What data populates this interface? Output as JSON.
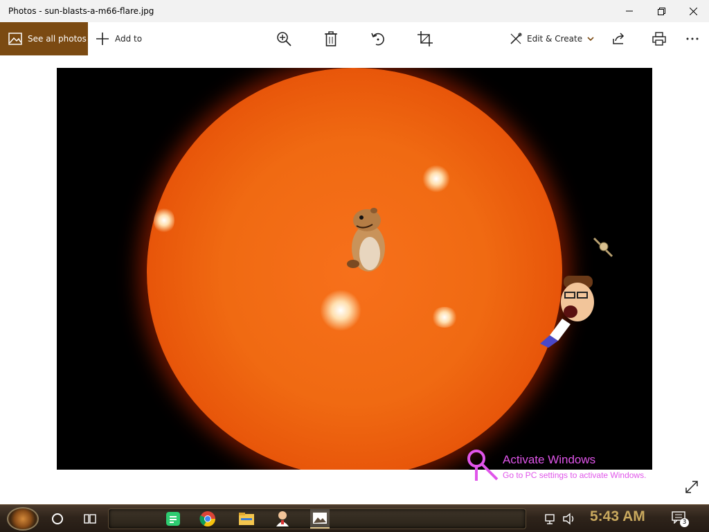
{
  "window": {
    "title": "Photos - sun-blasts-a-m66-flare.jpg",
    "controls": [
      "minimize-icon",
      "maximize-icon",
      "close-icon"
    ]
  },
  "toolbar": {
    "see_all_label": "See all photos",
    "add_to_label": "Add to",
    "edit_create_label": "Edit & Create",
    "icons": [
      "zoom-icon",
      "delete-icon",
      "rotate-icon",
      "crop-icon",
      "share-icon",
      "print-icon",
      "more-icon"
    ],
    "accent_color": "#7b4a12"
  },
  "watermark": {
    "line1": "Activate Windows",
    "line2": "Go to PC settings to activate Windows.",
    "color": "#e055ea"
  },
  "taskbar": {
    "clock": "5:43 AM",
    "notification_count": "3",
    "apps": [
      "notes-app-icon",
      "chrome-icon",
      "file-explorer-icon",
      "user-app-icon",
      "photos-app-icon"
    ]
  }
}
